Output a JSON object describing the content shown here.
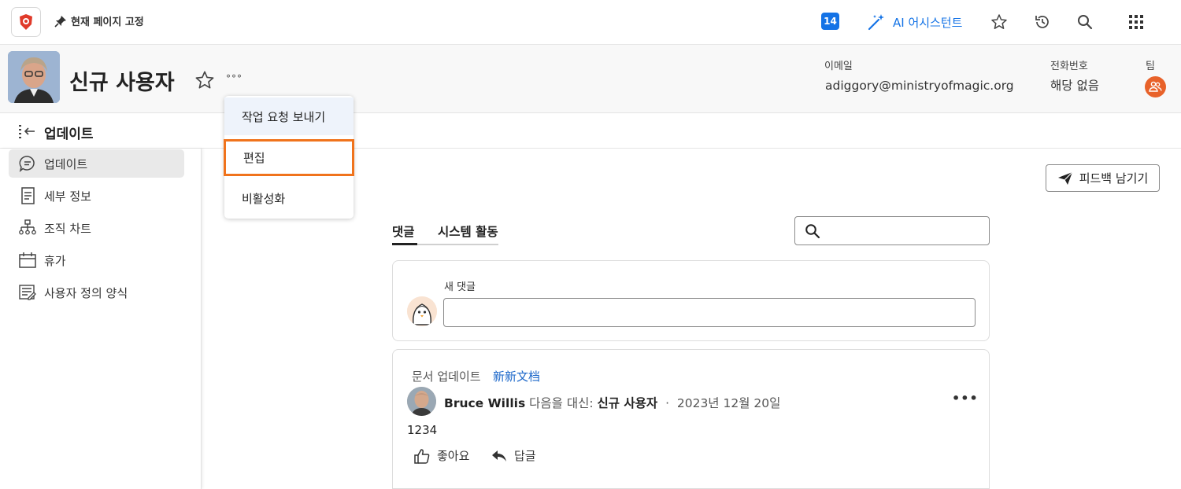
{
  "topbar": {
    "pin_label": "현재 페이지 고정",
    "notification_count": "14",
    "ai_label": "AI 어시스턴트"
  },
  "header": {
    "title": "신규 사용자",
    "more_label": "°°°",
    "email_label": "이메일",
    "email_value": "adiggory@ministryofmagic.org",
    "phone_label": "전화번호",
    "phone_value": "해당 없음",
    "team_label": "팀"
  },
  "dropdown": {
    "items": [
      "작업 요청 보내기",
      "편집",
      "비활성화"
    ]
  },
  "updates_bar": {
    "title": "업데이트"
  },
  "sidebar": {
    "items": [
      {
        "label": "업데이트",
        "icon": "comment-icon"
      },
      {
        "label": "세부 정보",
        "icon": "document-icon"
      },
      {
        "label": "조직 차트",
        "icon": "org-chart-icon"
      },
      {
        "label": "휴가",
        "icon": "calendar-icon"
      },
      {
        "label": "사용자 정의 양식",
        "icon": "form-icon"
      }
    ]
  },
  "main": {
    "feedback_label": "피드백 남기기",
    "tabs": [
      "댓글",
      "시스템 활동"
    ],
    "new_comment_label": "새 댓글",
    "post": {
      "type": "문서 업데이트",
      "link": "新新文档",
      "author": "Bruce Willis",
      "on_behalf": "다음을 대신:",
      "target": "신규 사용자",
      "separator": "·",
      "date": "2023년 12월 20일",
      "more": "•••",
      "body": "1234",
      "like_label": "좋아요",
      "reply_label": "답글"
    }
  },
  "colors": {
    "accent": "#1473e6",
    "highlight": "#f0731c",
    "team": "#e8622a"
  }
}
